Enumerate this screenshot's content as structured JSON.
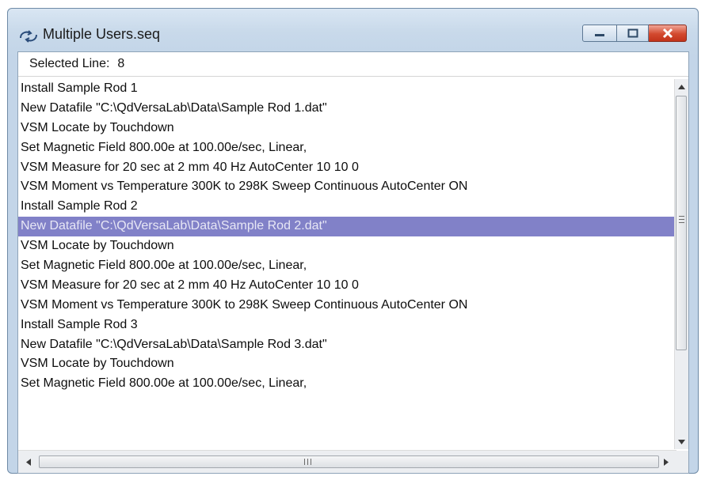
{
  "window": {
    "title": "Multiple Users.seq",
    "icon": "sequence-icon"
  },
  "header": {
    "selected_label": "Selected Line:",
    "selected_value": "8"
  },
  "sequence_lines": [
    "Install Sample Rod 1",
    "New Datafile \"C:\\QdVersaLab\\Data\\Sample Rod 1.dat\"",
    "VSM Locate by Touchdown",
    "Set Magnetic Field 800.00e at 100.00e/sec, Linear,",
    "VSM Measure for 20 sec at 2 mm 40 Hz AutoCenter 10 10 0",
    "VSM Moment vs Temperature 300K to 298K Sweep Continuous AutoCenter ON",
    "Install Sample Rod 2",
    "New Datafile \"C:\\QdVersaLab\\Data\\Sample Rod 2.dat\"",
    "VSM Locate by Touchdown",
    "Set Magnetic Field 800.00e at 100.00e/sec, Linear,",
    "VSM Measure for 20 sec at 2 mm 40 Hz AutoCenter 10 10 0",
    "VSM Moment vs Temperature 300K to 298K Sweep Continuous AutoCenter ON",
    "Install Sample Rod 3",
    "New Datafile \"C:\\QdVersaLab\\Data\\Sample Rod 3.dat\"",
    "VSM Locate by Touchdown",
    "Set Magnetic Field 800.00e at 100.00e/sec, Linear,"
  ],
  "selected_index": 7,
  "colors": {
    "selection": "#8181c8",
    "close_button": "#d3492e"
  }
}
